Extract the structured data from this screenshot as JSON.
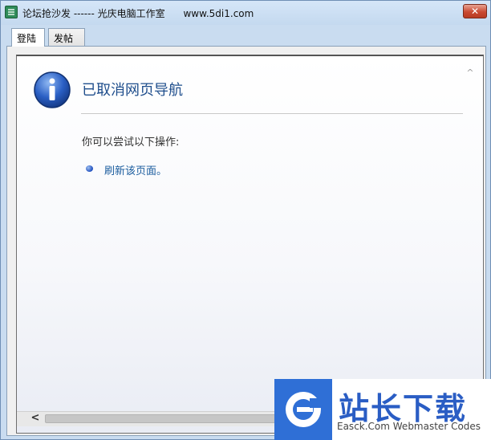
{
  "window": {
    "title": "论坛抢沙发 ------ 光庆电脑工作室      www.5di1.com",
    "close_label": "✕"
  },
  "tabs": [
    {
      "label": "登陆",
      "active": true
    },
    {
      "label": "发帖",
      "active": false
    }
  ],
  "page": {
    "heading": "已取消网页导航",
    "hint": "你可以尝试以下操作:",
    "refresh_link": "刷新该页面。"
  },
  "scrollbar": {
    "left_arrow": "<",
    "up_arrow": "^"
  },
  "watermark": {
    "title": "站长下载",
    "subtitle": "Easck.Com Webmaster Codes"
  },
  "colors": {
    "heading": "#1f4e8c",
    "link": "#1a5c9e",
    "watermark_blue": "#2f6fd6"
  },
  "icons": [
    "app-icon",
    "info-icon",
    "bullet-icon",
    "close-icon"
  ]
}
